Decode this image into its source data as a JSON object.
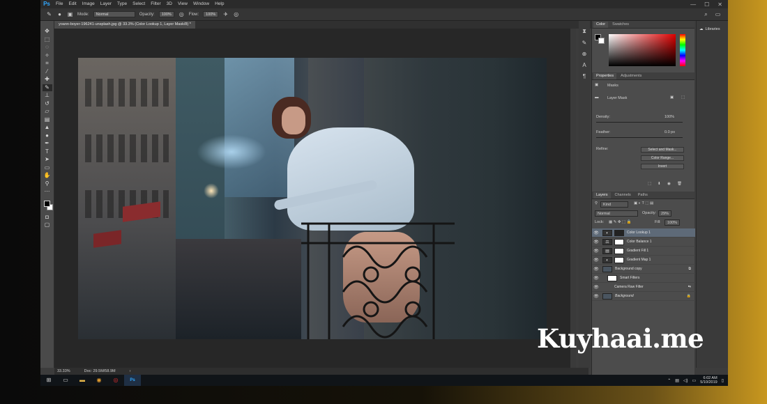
{
  "app": {
    "logo": "Ps",
    "menu": [
      "File",
      "Edit",
      "Image",
      "Layer",
      "Type",
      "Select",
      "Filter",
      "3D",
      "View",
      "Window",
      "Help"
    ],
    "window_controls": [
      "—",
      "☐",
      "✕"
    ]
  },
  "options_bar": {
    "mode_label": "Mode:",
    "mode_value": "Normal",
    "opacity_label": "Opacity:",
    "opacity_value": "100%",
    "flow_label": "Flow:",
    "flow_value": "100%"
  },
  "document": {
    "tab_title": "yoann-boyer-196241-unsplash.jpg @ 33.3% (Color Lookup 1, Layer Mask/8) *",
    "zoom": "33.33%",
    "doc_size": "Doc: 29.5M/58.9M"
  },
  "panels": {
    "color_tabs": [
      "Color",
      "Swatches"
    ],
    "libraries_label": "Libraries",
    "properties_tabs": [
      "Properties",
      "Adjustments"
    ],
    "properties": {
      "masks_label": "Masks",
      "layer_mask_label": "Layer Mask",
      "density_label": "Density:",
      "density_value": "100%",
      "feather_label": "Feather:",
      "feather_value": "0.0 px",
      "refine_label": "Refine:",
      "buttons": [
        "Select and Mask...",
        "Color Range...",
        "Invert"
      ]
    },
    "layers_tabs": [
      "Layers",
      "Channels",
      "Paths"
    ],
    "layers": {
      "filter_kind": "Kind",
      "blend_mode": "Normal",
      "opacity_label": "Opacity:",
      "opacity_value": "29%",
      "lock_label": "Lock:",
      "fill_label": "Fill:",
      "fill_value": "100%",
      "items": [
        {
          "name": "Color Lookup 1",
          "selected": true
        },
        {
          "name": "Color Balance 1",
          "selected": false
        },
        {
          "name": "Gradient Fill 1",
          "selected": false
        },
        {
          "name": "Gradient Map 1",
          "selected": false
        },
        {
          "name": "Background copy",
          "selected": false
        },
        {
          "name": "Smart Filters",
          "selected": false
        },
        {
          "name": "Camera Raw Filter",
          "selected": false
        },
        {
          "name": "Background",
          "selected": false
        }
      ]
    }
  },
  "taskbar": {
    "time": "6:02 AM",
    "date": "5/10/2019"
  },
  "watermark": "Kuyhaai.me",
  "colors": {
    "accent": "#31a8ff",
    "selected_layer": "#5e6a78"
  }
}
